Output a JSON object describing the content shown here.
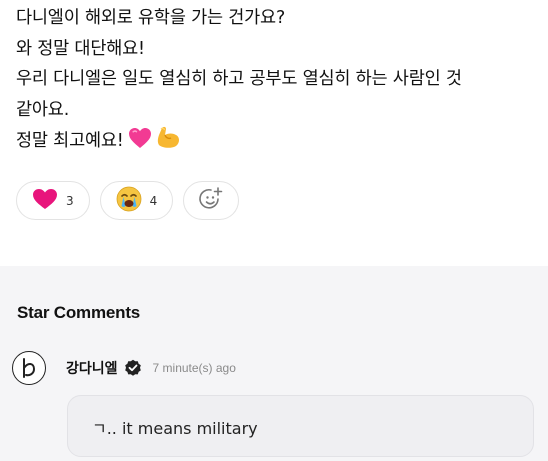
{
  "post": {
    "lines": [
      "다니엘이 해외로 유학을 가는 건가요?",
      "와 정말 대단해요!",
      "우리 다니엘은 일도 열심히 하고 공부도 열심히 하는 사람인 것",
      "같아요.",
      "정말 최고예요!"
    ],
    "line_emojis": [
      "pink-heart-emoji",
      "flexed-biceps-emoji"
    ]
  },
  "reactions": [
    {
      "icon": "heart-icon",
      "count": "3",
      "color": "#e8157c"
    },
    {
      "icon": "crying-face-icon",
      "count": "4",
      "color": "#f5c542"
    },
    {
      "icon": "add-reaction-icon"
    }
  ],
  "star_comments": {
    "title": "Star Comments",
    "comments": [
      {
        "author": "강다니엘",
        "verified_icon": "verified-check-icon",
        "time": "7 minute(s) ago",
        "text": "ㄱ.. it means military"
      }
    ]
  },
  "colors": {
    "band_background": "#f5f5f7",
    "bubble_background": "#efeff2",
    "heart": "#e8157c"
  }
}
